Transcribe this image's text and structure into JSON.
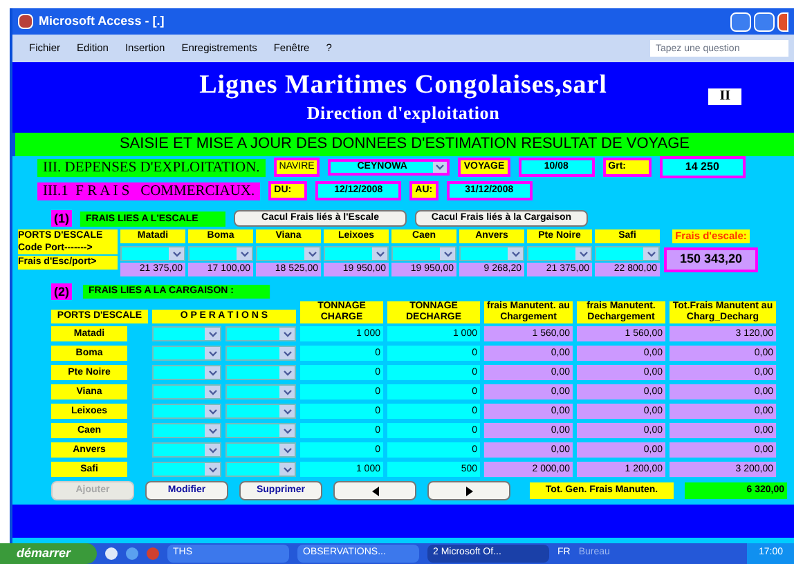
{
  "window": {
    "title": "Microsoft Access - [.]"
  },
  "menu": [
    {
      "label": "Fichier"
    },
    {
      "label": "Edition"
    },
    {
      "label": "Insertion"
    },
    {
      "label": "Enregistrements"
    },
    {
      "label": "Fenêtre"
    },
    {
      "label": "?"
    }
  ],
  "help": {
    "placeholder": "Tapez une question"
  },
  "header": {
    "company": "Lignes Maritimes Congolaises,sarl",
    "department": "Direction d'exploitation",
    "badge": "II"
  },
  "banner": "SAISIE ET MISE A JOUR DES DONNEES D'ESTIMATION RESULTAT DE VOYAGE",
  "section": {
    "title": "III. DEPENSES D'EXPLOITATION.",
    "navire_label": "NAVIRE",
    "navire": "CEYNOWA",
    "voyage_label": "VOYAGE",
    "voyage": "10/08",
    "grt_label": "Grt:",
    "grt": "14 250"
  },
  "subsection": {
    "title": "III.1  F R A I S   COMMERCIAUX.",
    "du_label": "DU:",
    "du": "12/12/2008",
    "au_label": "AU:",
    "au": "31/12/2008"
  },
  "part1": {
    "number": "(1)",
    "title": "FRAIS LIES A L'ESCALE",
    "buttons": [
      "Cacul Frais liés à l'Escale",
      "Cacul Frais liés à la Cargaison"
    ],
    "row_labels": [
      "PORTS D'ESCALE",
      "Code Port------->",
      "Frais d'Esc/port>"
    ],
    "ports": [
      {
        "name": "Matadi",
        "amount": "21 375,00"
      },
      {
        "name": "Boma",
        "amount": "17 100,00"
      },
      {
        "name": "Viana",
        "amount": "18 525,00"
      },
      {
        "name": "Leixoes",
        "amount": "19 950,00"
      },
      {
        "name": "Caen",
        "amount": "19 950,00"
      },
      {
        "name": "Anvers",
        "amount": "9 268,20"
      },
      {
        "name": "Pte Noire",
        "amount": "21 375,00"
      },
      {
        "name": "Safi",
        "amount": "22 800,00"
      }
    ],
    "total_label": "Frais d'escale:",
    "total": "150 343,20"
  },
  "part2": {
    "number": "(2)",
    "title": "FRAIS LIES A LA CARGAISON :",
    "columns": [
      "PORTS D'ESCALE",
      "O P E R A T I O N S",
      "TONNAGE CHARGE",
      "TONNAGE DECHARGE",
      "frais Manutent. au Chargement",
      "frais Manutent. Dechargement",
      "Tot.Frais Manutent au Charg_Decharg"
    ],
    "rows": [
      {
        "port": "Matadi",
        "charge": "1 000",
        "decharge": "1 000",
        "frais_charg": "1 560,00",
        "frais_dech": "1 560,00",
        "total": "3 120,00"
      },
      {
        "port": "Boma",
        "charge": "0",
        "decharge": "0",
        "frais_charg": "0,00",
        "frais_dech": "0,00",
        "total": "0,00"
      },
      {
        "port": "Pte Noire",
        "charge": "0",
        "decharge": "0",
        "frais_charg": "0,00",
        "frais_dech": "0,00",
        "total": "0,00"
      },
      {
        "port": "Viana",
        "charge": "0",
        "decharge": "0",
        "frais_charg": "0,00",
        "frais_dech": "0,00",
        "total": "0,00"
      },
      {
        "port": "Leixoes",
        "charge": "0",
        "decharge": "0",
        "frais_charg": "0,00",
        "frais_dech": "0,00",
        "total": "0,00"
      },
      {
        "port": "Caen",
        "charge": "0",
        "decharge": "0",
        "frais_charg": "0,00",
        "frais_dech": "0,00",
        "total": "0,00"
      },
      {
        "port": "Anvers",
        "charge": "0",
        "decharge": "0",
        "frais_charg": "0,00",
        "frais_dech": "0,00",
        "total": "0,00"
      },
      {
        "port": "Safi",
        "charge": "1 000",
        "decharge": "500",
        "frais_charg": "2 000,00",
        "frais_dech": "1 200,00",
        "total": "3 200,00"
      }
    ],
    "buttons": [
      {
        "label": "Ajouter",
        "disabled": true
      },
      {
        "label": "Modifier",
        "disabled": false
      },
      {
        "label": "Supprimer",
        "disabled": false
      }
    ],
    "total_label": "Tot. Gen. Frais Manuten.",
    "total": "6 320,00"
  },
  "taskbar": {
    "start": "démarrer",
    "tasks": [
      {
        "label": "THS",
        "selected": false
      },
      {
        "label": "OBSERVATIONS...",
        "selected": false
      },
      {
        "label": "2 Microsoft Of...",
        "selected": true
      }
    ],
    "lang": "FR",
    "desktop": "Bureau",
    "clock": "17:00"
  }
}
